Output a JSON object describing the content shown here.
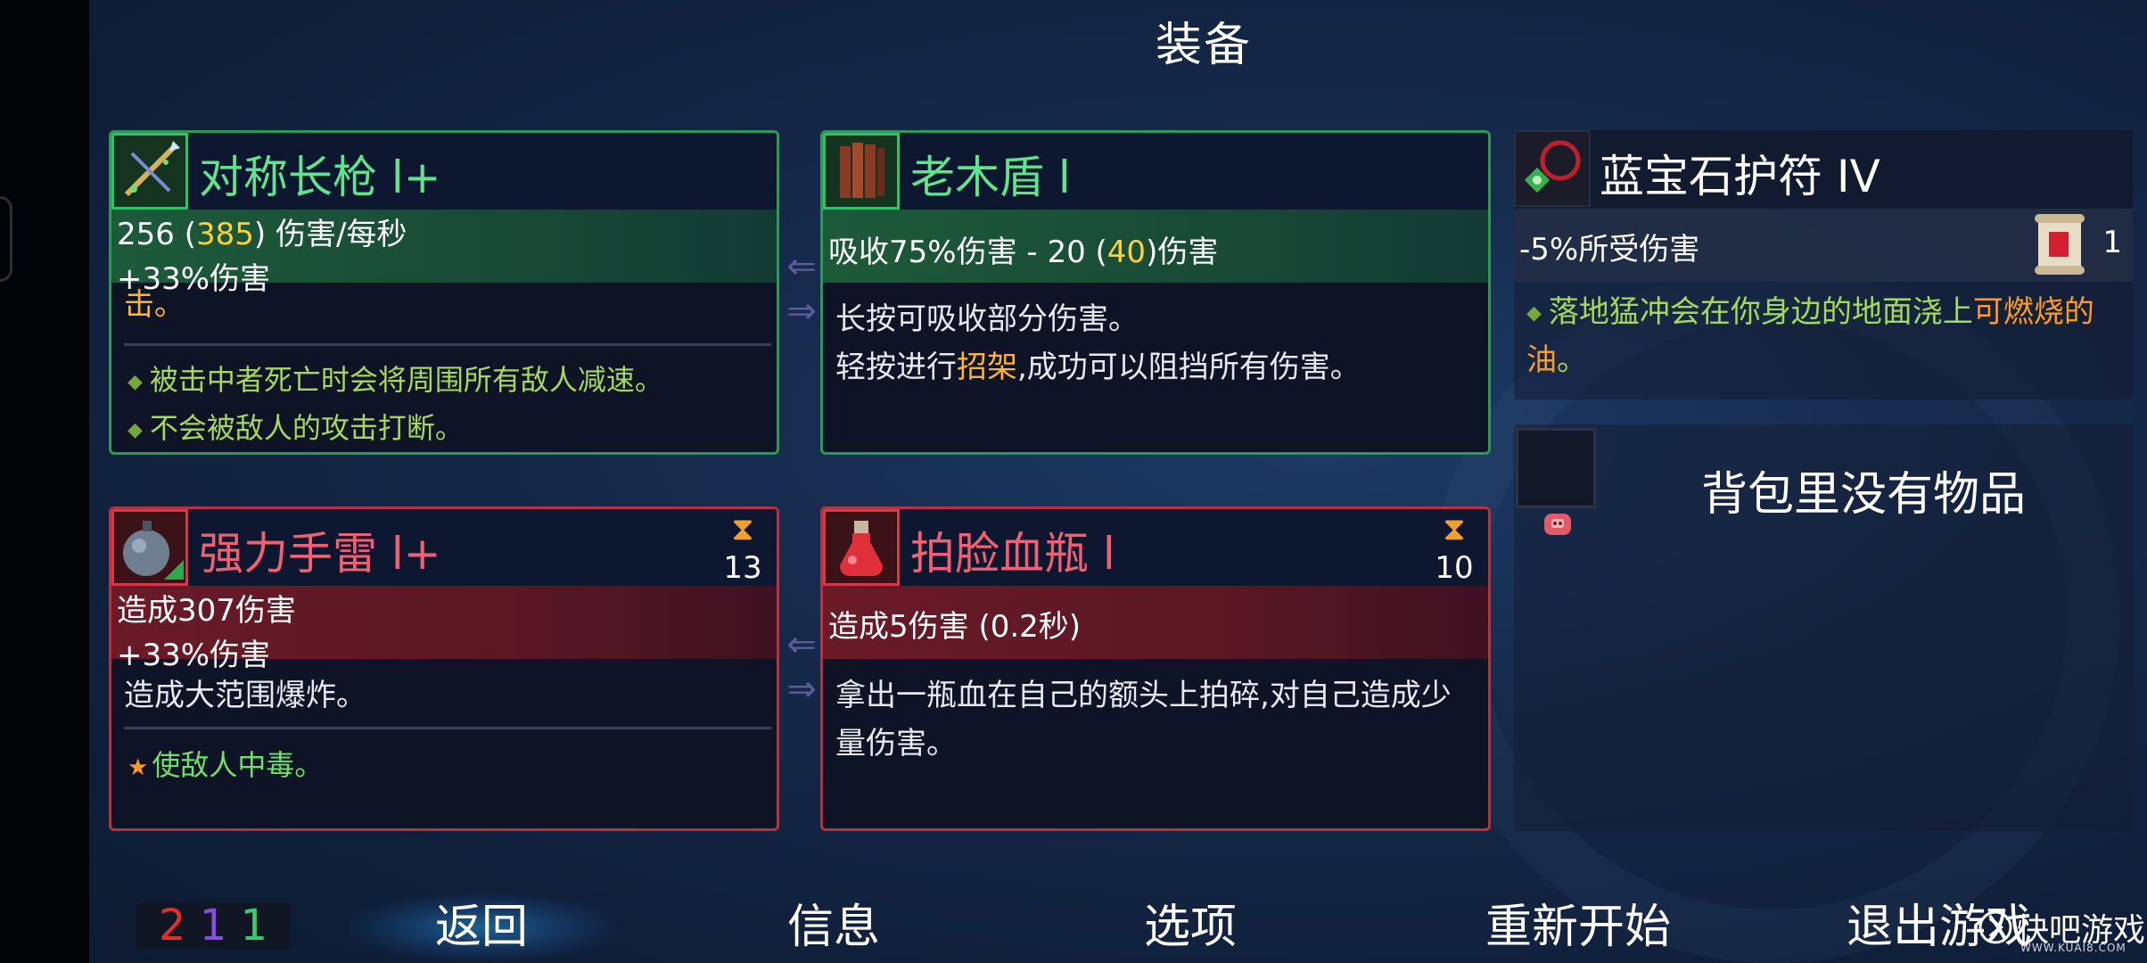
{
  "screen_title": "装备",
  "cards": {
    "spear": {
      "name": "对称长枪 l+",
      "stat1_base": "256 (",
      "stat1_crit": "385",
      "stat1_suffix": ") 伤害/每秒",
      "stat2": "+33%伤害",
      "desc_tail": "击。",
      "bullet1": "被击中者死亡时会将周围所有敌人减速。",
      "bullet2": "不会被敌人的攻击打断。"
    },
    "shield": {
      "name": "老木盾 l",
      "stat1_pre": "吸收75%伤害 - 20 (",
      "stat1_hi": "40",
      "stat1_post": ")伤害",
      "desc_line1": "长按可吸收部分伤害。",
      "desc_line2_pre": "轻按进行",
      "desc_line2_hi": "招架",
      "desc_line2_post": ",成功可以阻挡所有伤害。"
    },
    "grenade": {
      "name": "强力手雷 l+",
      "cooldown": "13",
      "stat1": "造成307伤害",
      "stat2": "+33%伤害",
      "desc": "造成大范围爆炸。",
      "bullet": "使敌人中毒。"
    },
    "flask": {
      "name": "拍脸血瓶 l",
      "cooldown": "10",
      "stat1": "造成5伤害 (0.2秒)",
      "desc_line1": "拿出一瓶血在自己的额头上拍碎,对自己造成少",
      "desc_line2": "量伤害。"
    }
  },
  "amulet": {
    "name": "蓝宝石护符 IV",
    "stat": "-5%所受伤害",
    "scroll_count": "1",
    "effect_pre": "落地猛冲会在你身边的地面浇上",
    "effect_hi": "可燃烧的",
    "effect_line2_hi": "油",
    "effect_line2_post": "。"
  },
  "backpack": {
    "empty_text": "背包里没有物品"
  },
  "scroll_counter": {
    "red": "2",
    "purple": "1",
    "green": "1"
  },
  "menu": {
    "back": "返回",
    "info": "信息",
    "options": "选项",
    "restart": "重新开始",
    "quit": "退出游戏"
  },
  "watermark": {
    "text": "快吧游戏",
    "sub": "WWW.KUAI8.COM"
  },
  "colors": {
    "weapon_border": "#2c9957",
    "skill_border": "#b6323f",
    "crit_yellow": "#ffd233",
    "effect_green": "#a6d85a",
    "highlight_orange": "#ff9a20"
  }
}
